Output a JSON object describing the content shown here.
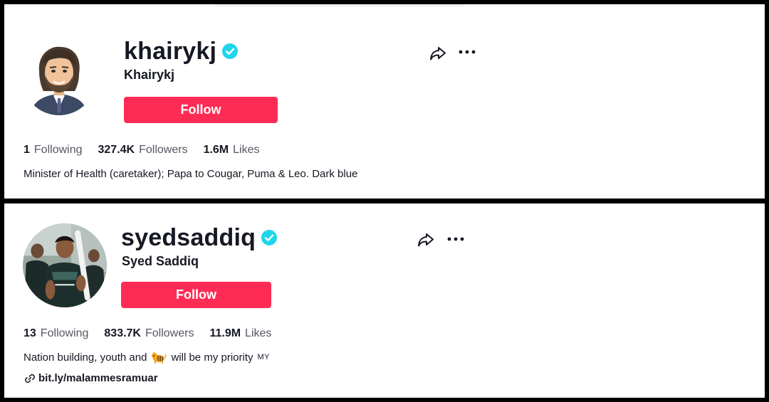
{
  "profiles": [
    {
      "username": "khairykj",
      "nickname": "Khairykj",
      "follow_label": "Follow",
      "stats": [
        {
          "value": "1",
          "label": "Following"
        },
        {
          "value": "327.4K",
          "label": "Followers"
        },
        {
          "value": "1.6M",
          "label": "Likes"
        }
      ],
      "bio": "Minister of Health (caretaker); Papa to Cougar, Puma & Leo. Dark blue"
    },
    {
      "username": "syedsaddiq",
      "nickname": "Syed Saddiq",
      "follow_label": "Follow",
      "stats": [
        {
          "value": "13",
          "label": "Following"
        },
        {
          "value": "833.7K",
          "label": "Followers"
        },
        {
          "value": "11.9M",
          "label": "Likes"
        }
      ],
      "bio_before": "Nation building, youth and",
      "bio_emoji": "tiger-emoji",
      "bio_after": "will be my priority",
      "bio_flag": "MY",
      "link": "bit.ly/malammesramuar"
    }
  ],
  "colors": {
    "accent": "#fe2c55",
    "verified": "#20d5ec",
    "text": "#161823",
    "muted": "#565862"
  },
  "icons": {
    "verified": "verified-badge-icon",
    "share": "share-arrow-icon",
    "more": "more-dots-icon",
    "link": "link-icon"
  }
}
